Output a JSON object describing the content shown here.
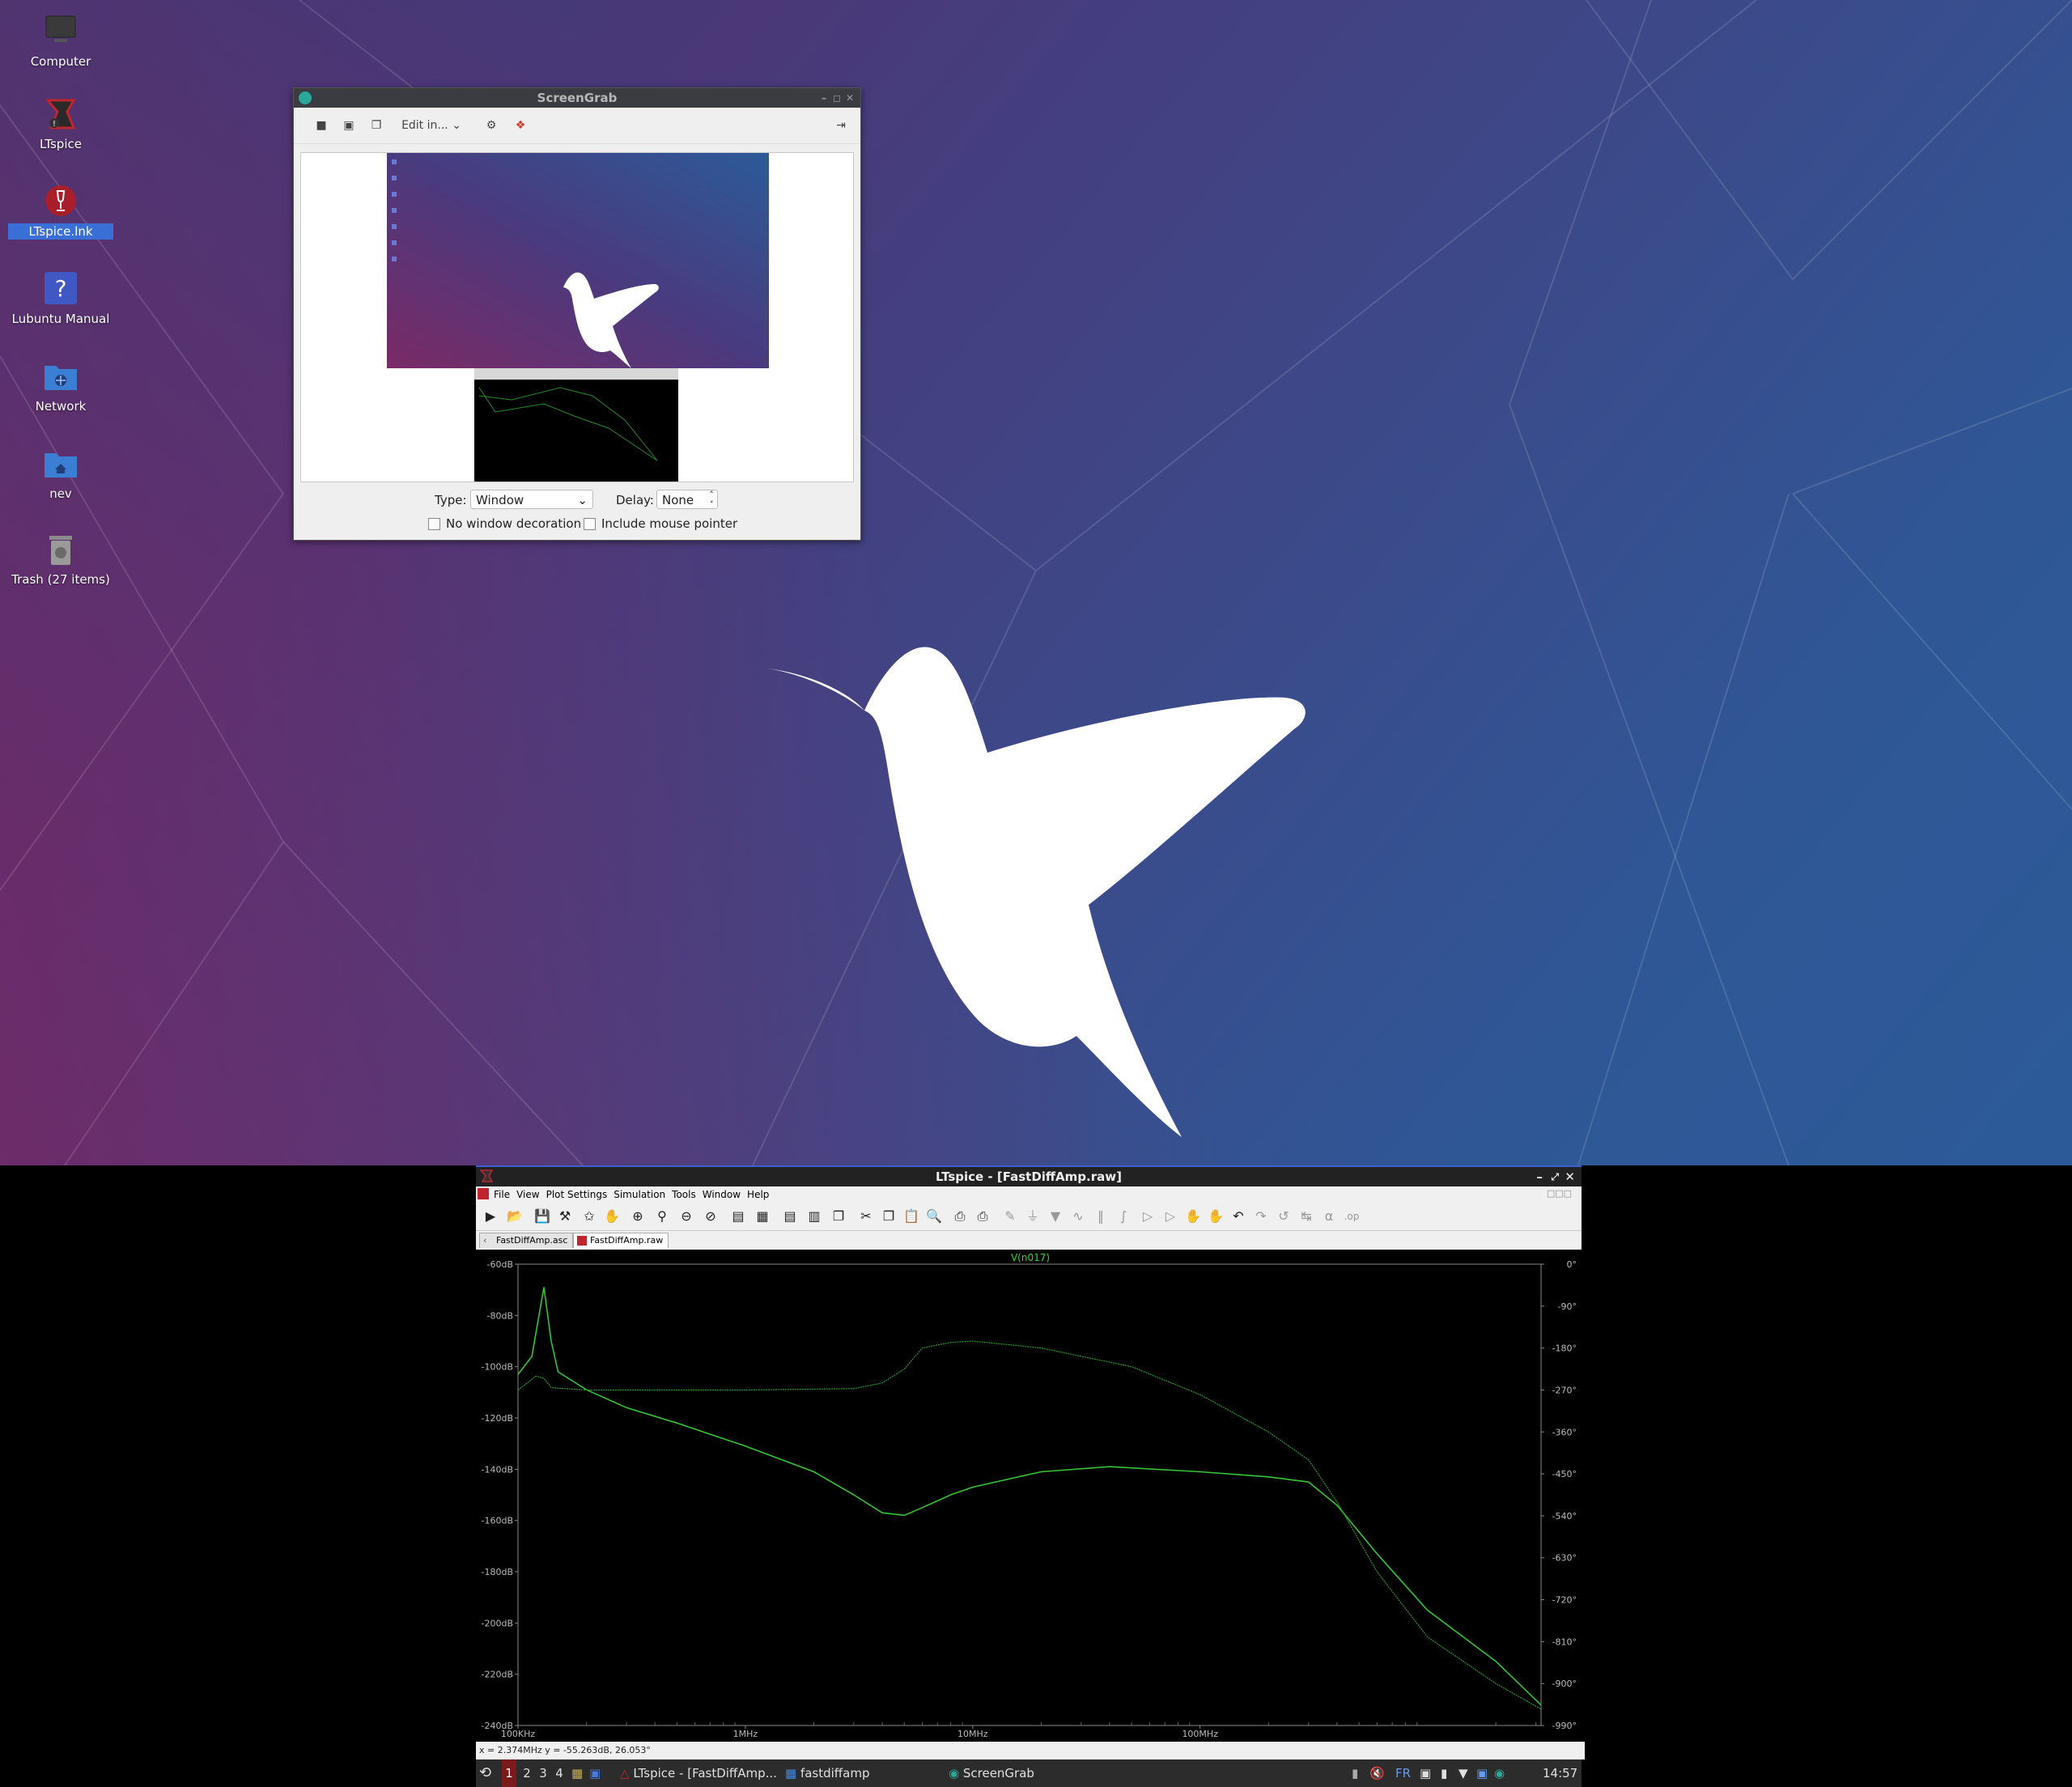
{
  "desktop": {
    "icons": [
      {
        "label": "Computer",
        "selected": false
      },
      {
        "label": "LTspice",
        "selected": false
      },
      {
        "label": "LTspice.lnk",
        "selected": true
      },
      {
        "label": "Lubuntu Manual",
        "selected": false
      },
      {
        "label": "Network",
        "selected": false
      },
      {
        "label": "nev",
        "selected": false
      },
      {
        "label": "Trash (27 items)",
        "selected": false
      }
    ]
  },
  "screengrab": {
    "title": "ScreenGrab",
    "edit_label": "Edit in...",
    "type_label": "Type:",
    "type_value": "Window",
    "delay_label": "Delay:",
    "delay_value": "None",
    "no_decoration_label": "No window decoration",
    "include_pointer_label": "Include mouse pointer"
  },
  "ltspice": {
    "title": "LTspice - [FastDiffAmp.raw]",
    "menu": [
      "File",
      "View",
      "Plot Settings",
      "Simulation",
      "Tools",
      "Window",
      "Help"
    ],
    "tabs": [
      "FastDiffAmp.asc",
      "FastDiffAmp.raw"
    ],
    "active_tab": 1,
    "status": "x = 2.374MHz    y = -55.263dB, 26.053°"
  },
  "taskbar": {
    "workspaces": [
      "1",
      "2",
      "3",
      "4"
    ],
    "tasks": [
      "LTspice - [FastDiffAmp...",
      "fastdiffamp",
      "ScreenGrab"
    ],
    "lang": "FR",
    "clock": "14:57"
  },
  "chart_data": {
    "type": "line",
    "title": "V(n017)",
    "xscale": "log",
    "xlim": [
      100000,
      3160000000
    ],
    "x_ticks": [
      "100KHz",
      "1MHz",
      "10MHz",
      "100MHz"
    ],
    "y_ticks": [
      "-60dB",
      "-80dB",
      "-100dB",
      "-120dB",
      "-140dB",
      "-160dB",
      "-180dB",
      "-200dB",
      "-220dB",
      "-240dB"
    ],
    "ylim": [
      -240,
      -60
    ],
    "y2_ticks": [
      "0°",
      "-90°",
      "-180°",
      "-270°",
      "-360°",
      "-450°",
      "-540°",
      "-630°",
      "-720°",
      "-810°",
      "-900°",
      "-990°"
    ],
    "y2lim": [
      -990,
      0
    ],
    "series": [
      {
        "name": "magnitude",
        "x": [
          100000,
          115000,
          130000,
          140000,
          150000,
          200000,
          300000,
          500000,
          1000000,
          2000000,
          3000000,
          4000000,
          5000000,
          6000000,
          8000000,
          10000000,
          20000000,
          40000000,
          100000000,
          200000000,
          300000000,
          400000000,
          600000000,
          1000000000,
          2000000000,
          3160000000
        ],
        "y": [
          -103,
          -96,
          -69,
          -90,
          -102,
          -109,
          -116,
          -122,
          -131,
          -141,
          -150,
          -157,
          -158,
          -155,
          -150,
          -147,
          -141,
          -139,
          -141,
          -143,
          -145,
          -154,
          -173,
          -195,
          -215,
          -232
        ]
      },
      {
        "name": "phase",
        "x": [
          100000,
          120000,
          130000,
          140000,
          200000,
          1000000,
          3000000,
          4000000,
          5000000,
          6000000,
          8000000,
          10000000,
          20000000,
          50000000,
          100000000,
          200000000,
          300000000,
          400000000,
          600000000,
          1000000000,
          2000000000,
          3160000000
        ],
        "y": [
          -270,
          -240,
          -245,
          -265,
          -270,
          -270,
          -267,
          -255,
          -225,
          -180,
          -168,
          -165,
          -180,
          -220,
          -280,
          -360,
          -420,
          -510,
          -660,
          -800,
          -900,
          -955
        ]
      }
    ]
  }
}
